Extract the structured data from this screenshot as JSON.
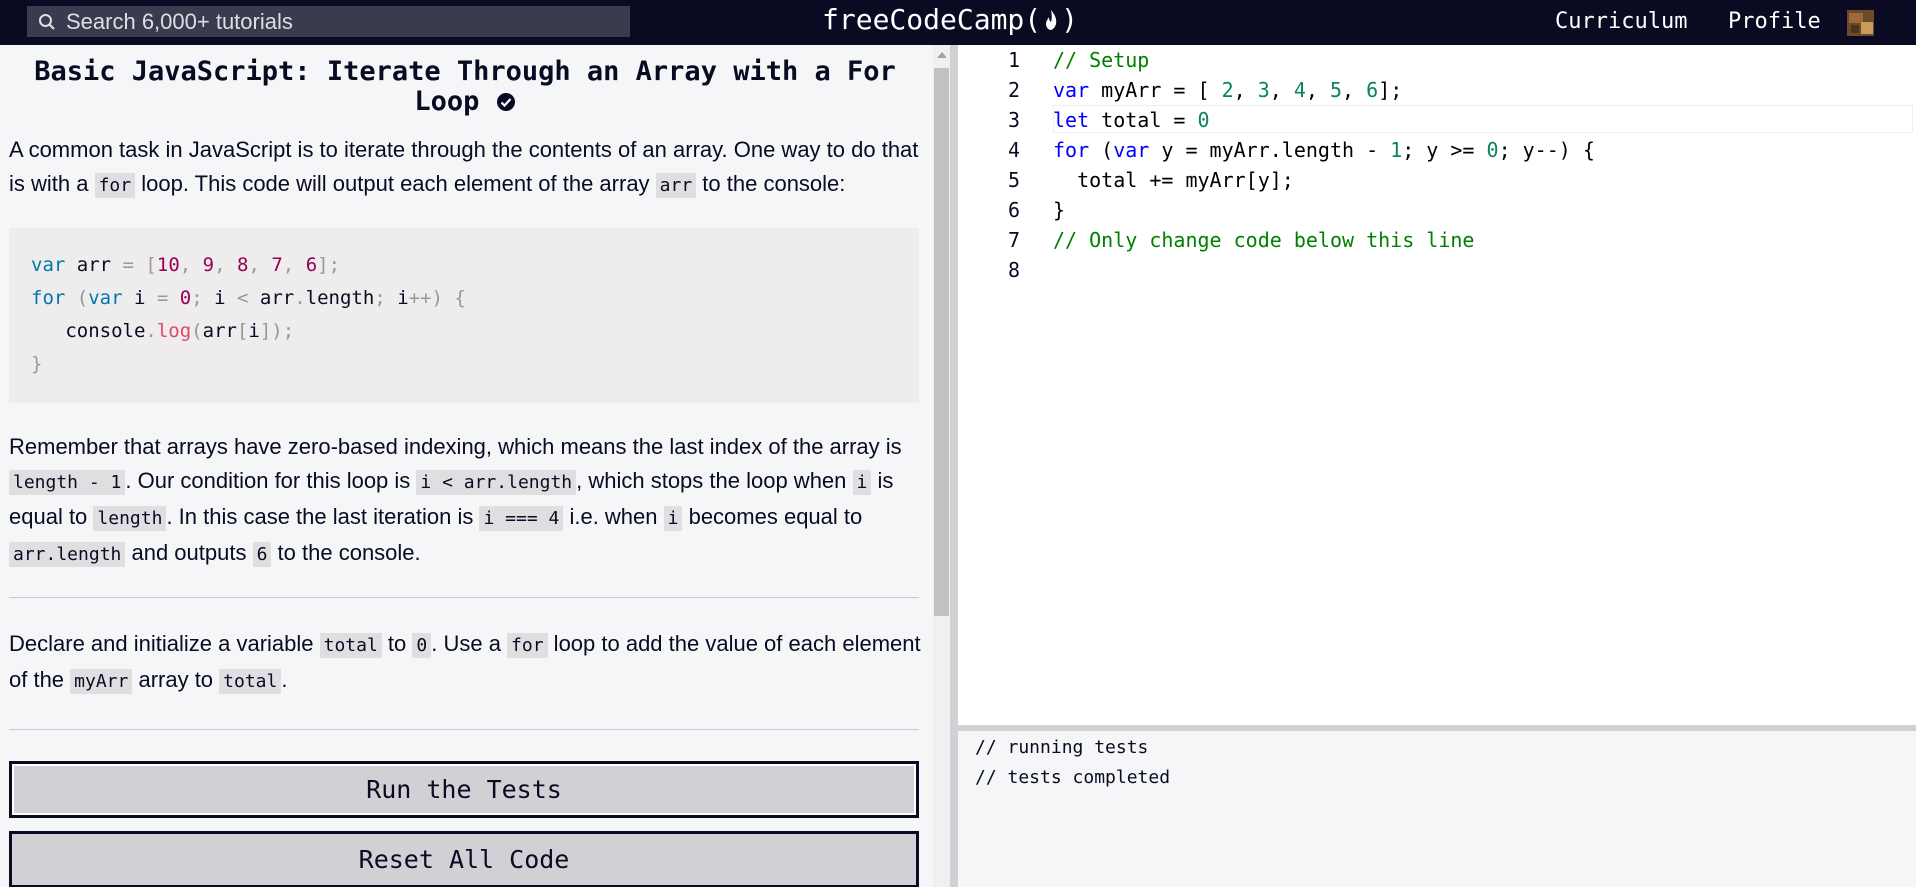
{
  "header": {
    "search_placeholder": "Search 6,000+ tutorials",
    "logo_text_left": "freeCodeCamp(",
    "logo_text_right": ")",
    "nav": {
      "curriculum": "Curriculum",
      "profile": "Profile"
    }
  },
  "lesson": {
    "title": "Basic JavaScript: Iterate Through an Array with a For Loop",
    "intro": {
      "t1": "A common task in JavaScript is to iterate through the contents of an array. One way to do that is with a ",
      "c1": "for",
      "t2": " loop. This code will output each element of the array ",
      "c2": "arr",
      "t3": " to the console:"
    },
    "example_code": {
      "l1": {
        "k1": "var",
        "t1": " arr ",
        "p1": "=",
        "p2": " [",
        "n1": "10",
        "p3": ", ",
        "n2": "9",
        "p4": ", ",
        "n3": "8",
        "p5": ", ",
        "n4": "7",
        "p6": ", ",
        "n5": "6",
        "p7": "];"
      },
      "l2": {
        "k1": "for",
        "p1": " (",
        "k2": "var",
        "t1": " i ",
        "p2": "=",
        "n1": " 0",
        "p3": ";",
        "t2": " i ",
        "p4": "<",
        "t3": " arr",
        "p5": ".",
        "t4": "length",
        "p6": ";",
        "t5": " i",
        "p7": "++",
        "p8": ") {"
      },
      "l3": {
        "t1": "   console",
        "p1": ".",
        "f1": "log",
        "p2": "(",
        "t2": "arr",
        "p3": "[",
        "t3": "i",
        "p4": "]);"
      },
      "l4": {
        "p1": "}"
      }
    },
    "para2": {
      "t1": "Remember that arrays have zero-based indexing, which means the last index of the array is ",
      "c1": "length - 1",
      "t2": ". Our condition for this loop is ",
      "c2": "i < arr.length",
      "t3": ", which stops the loop when ",
      "c3": "i",
      "t4": " is equal to ",
      "c4": "length",
      "t5": ". In this case the last iteration is ",
      "c5": "i === 4",
      "t6": " i.e. when ",
      "c6": "i",
      "t7": " becomes equal to ",
      "c7": "arr.length",
      "t8": " and outputs ",
      "c8": "6",
      "t9": " to the console."
    },
    "instructions": {
      "t1": "Declare and initialize a variable ",
      "c1": "total",
      "t2": " to ",
      "c2": "0",
      "t3": ". Use a ",
      "c3": "for",
      "t4": " loop to add the value of each element of the ",
      "c4": "myArr",
      "t5": " array to ",
      "c5": "total",
      "t6": "."
    },
    "buttons": {
      "run": "Run the Tests",
      "reset": "Reset All Code"
    }
  },
  "editor": {
    "lines": [
      {
        "num": "1",
        "code": "// Setup"
      },
      {
        "num": "2",
        "a": "var",
        "b": " myArr = [ ",
        "n1": "2",
        "s1": ", ",
        "n2": "3",
        "s2": ", ",
        "n3": "4",
        "s3": ", ",
        "n4": "5",
        "s4": ", ",
        "n5": "6",
        "e": "];"
      },
      {
        "num": "3",
        "a": "let",
        "b": " total = ",
        "n1": "0"
      },
      {
        "num": "4",
        "a": "for",
        "b": " (",
        "c": "var",
        "d": " y = myArr.length - ",
        "n1": "1",
        "e": "; y >= ",
        "n2": "0",
        "f": "; y--) {"
      },
      {
        "num": "5",
        "code": "  total += myArr[y];"
      },
      {
        "num": "6",
        "code": "}"
      },
      {
        "num": "7",
        "code": "// Only change code below this line"
      },
      {
        "num": "8",
        "code": ""
      }
    ]
  },
  "console": {
    "line1": "// running tests",
    "line2": "// tests completed"
  },
  "colors": {
    "nav_bg": "#0a0a23",
    "button_bg": "#d0d0d5",
    "comment_green": "#008000",
    "keyword_blue": "#0000ff"
  }
}
